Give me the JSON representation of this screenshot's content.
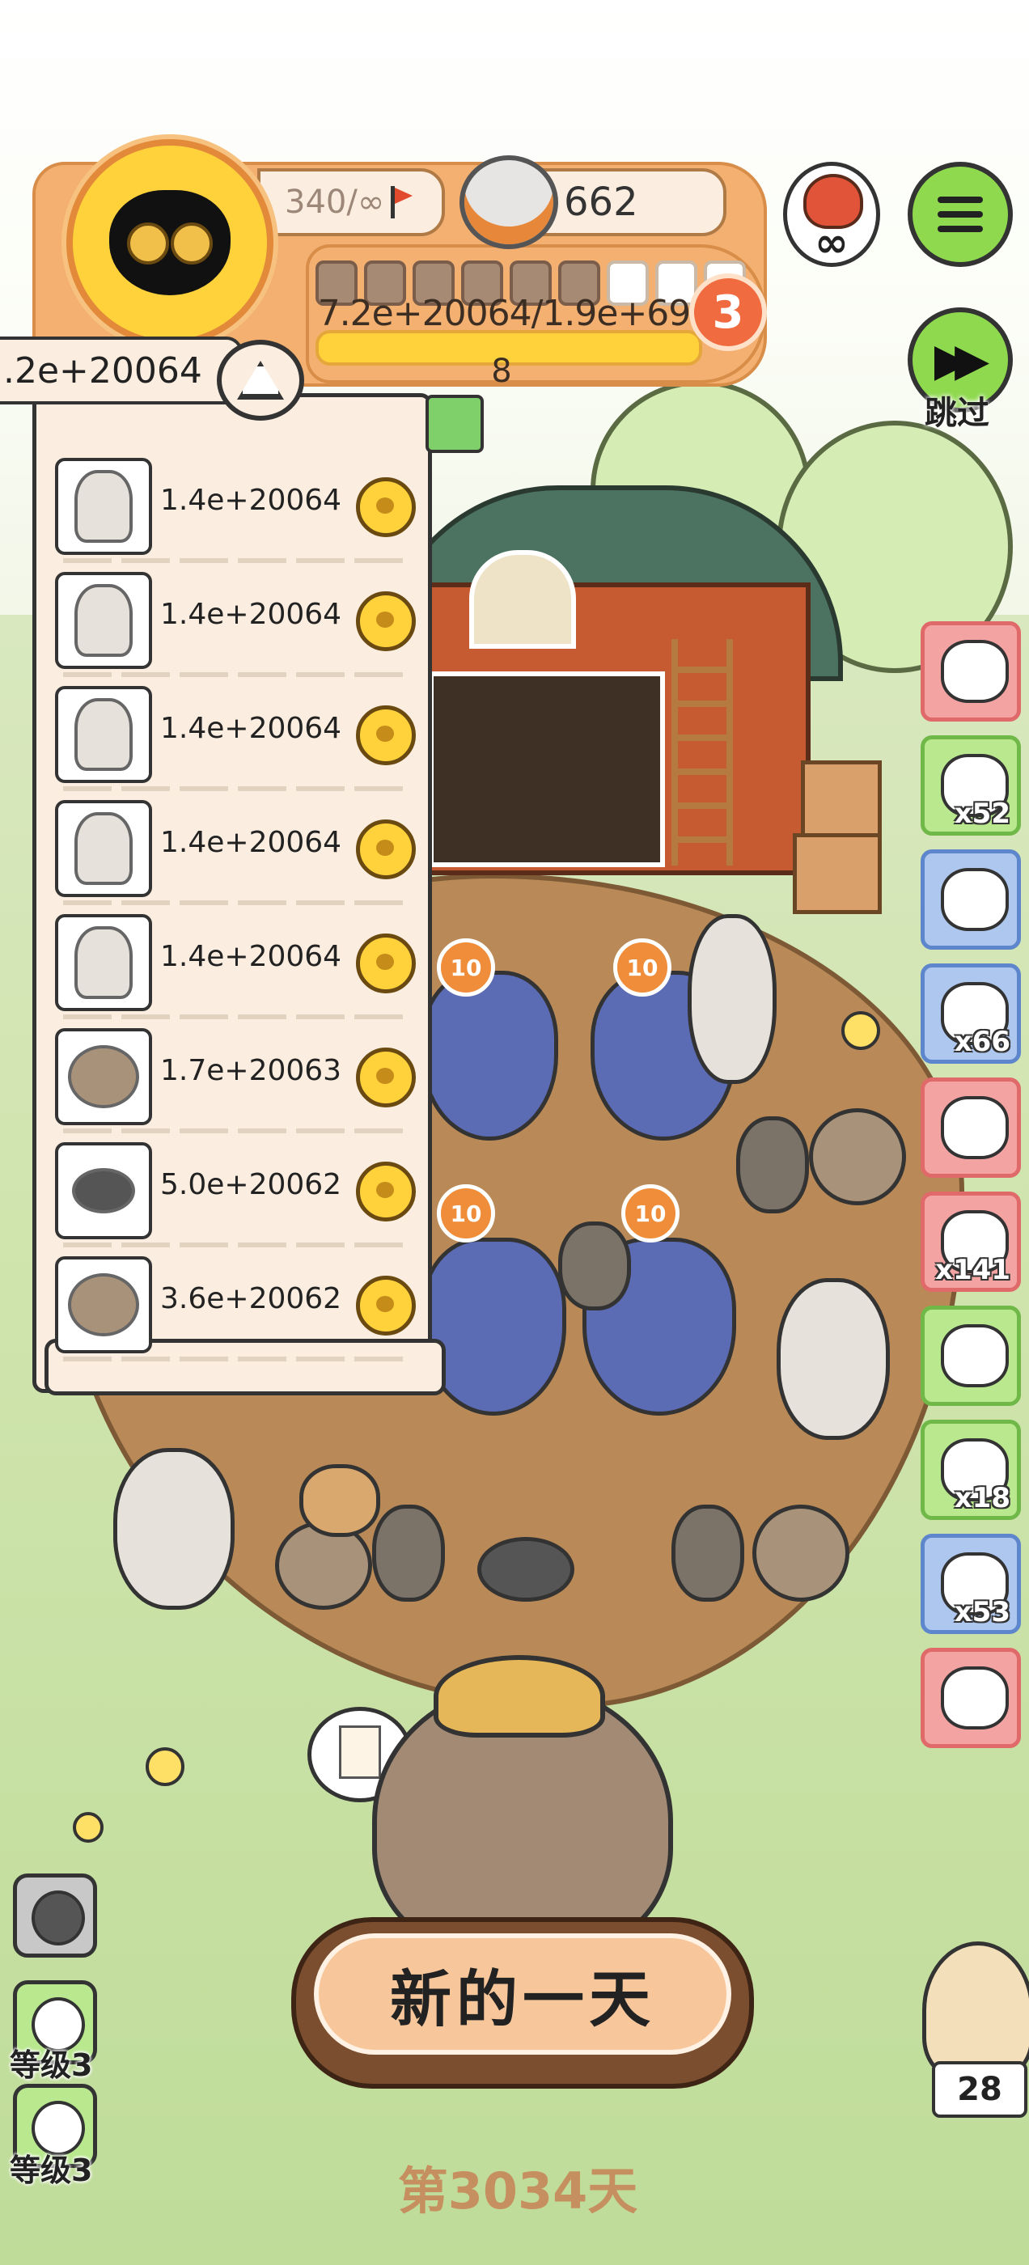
{
  "hud": {
    "stamina": "340/∞",
    "coins": "662",
    "xp_text": "7.2e+20064/1.9e+69",
    "xp_text_line2": "8",
    "level": "3",
    "infinity": "∞",
    "xp_segments_filled": 6,
    "xp_segments_total": 9
  },
  "total_value": ".2e+20064",
  "animal_list": [
    {
      "animal": "alpaca",
      "value": "1.4e+20064"
    },
    {
      "animal": "alpaca",
      "value": "1.4e+20064"
    },
    {
      "animal": "alpaca",
      "value": "1.4e+20064"
    },
    {
      "animal": "alpaca",
      "value": "1.4e+20064"
    },
    {
      "animal": "alpaca",
      "value": "1.4e+20064"
    },
    {
      "animal": "hedgehog",
      "value": "1.7e+20063"
    },
    {
      "animal": "mole",
      "value": "5.0e+20062"
    },
    {
      "animal": "hedgehog",
      "value": "3.6e+20062"
    }
  ],
  "skip_label": "跳过",
  "side_items": [
    {
      "color": "red",
      "icon": "pinecone-cat-icon",
      "count": ""
    },
    {
      "color": "green",
      "icon": "tent-icon",
      "count": "x52"
    },
    {
      "color": "blue",
      "icon": "sheep-icon",
      "count": ""
    },
    {
      "color": "blue",
      "icon": "sack-icon",
      "count": "x66"
    },
    {
      "color": "red",
      "icon": "cloud-icon",
      "count": ""
    },
    {
      "color": "red",
      "icon": "scroll-icon",
      "count": "x141"
    },
    {
      "color": "green",
      "icon": "card-icon",
      "count": ""
    },
    {
      "color": "green",
      "icon": "worm-icon",
      "count": "x18"
    },
    {
      "color": "blue",
      "icon": "bag-icon",
      "count": "x53"
    },
    {
      "color": "red",
      "icon": "rope-icon",
      "count": ""
    }
  ],
  "badges": [
    "10",
    "10",
    "10",
    "10"
  ],
  "new_day_button": "新的一天",
  "day_label": "第3034天",
  "left_buttons": [
    {
      "label": "",
      "color": "gray"
    },
    {
      "label": "等级3",
      "color": "green"
    },
    {
      "label": "等级3",
      "color": "green"
    }
  ],
  "owl_count": "28",
  "colors": {
    "accent": "#f3b070",
    "panel": "#fbeee0",
    "green": "#8fd94f"
  }
}
